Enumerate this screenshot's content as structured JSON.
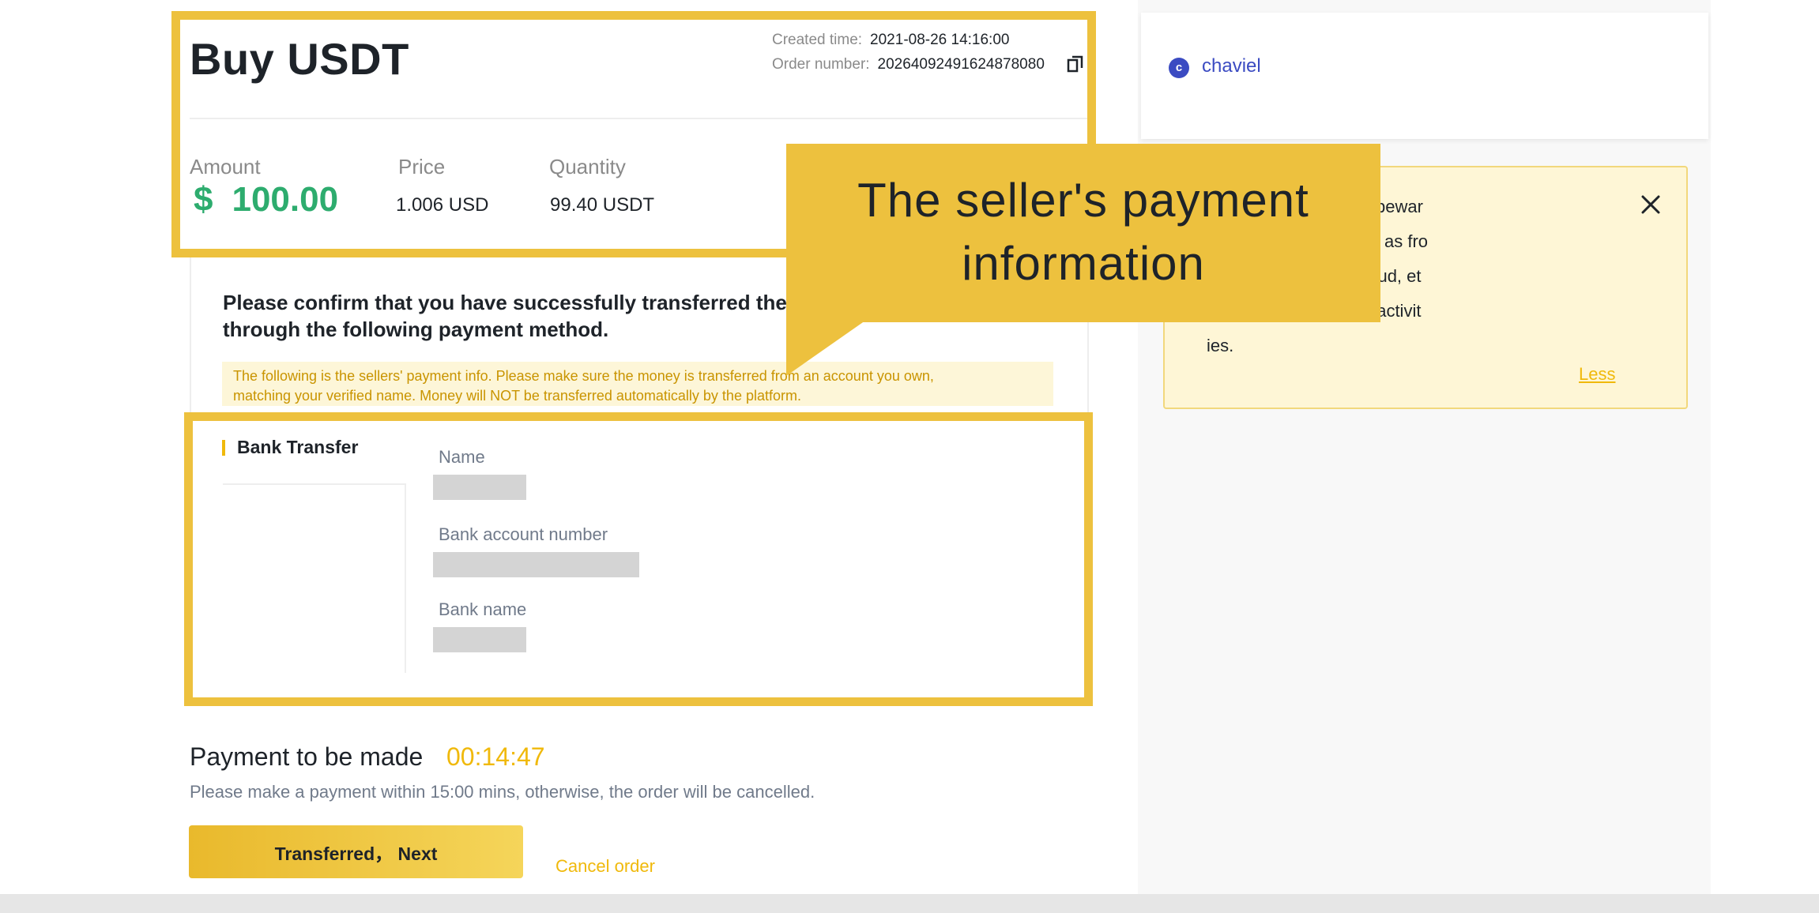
{
  "order": {
    "title": "Buy USDT",
    "created_label": "Created time:",
    "created_value": "2021-08-26 14:16:00",
    "order_label": "Order number:",
    "order_value": "20264092491624878080"
  },
  "stats": {
    "amount_label": "Amount",
    "amount_currency": "$",
    "amount_value": "100.00",
    "price_label": "Price",
    "price_value": "1.006",
    "price_unit": "USD",
    "quantity_label": "Quantity",
    "quantity_value": "99.40",
    "quantity_unit": "USDT"
  },
  "confirm": {
    "text_line1": "Please confirm that you have successfully transferred the",
    "text_line2": "through the following payment method.",
    "notice_line1": "The following is the sellers' payment info. Please make sure the money is transferred from an account you own,",
    "notice_line2": "matching your verified name. Money will NOT be transferred automatically by the platform."
  },
  "bank": {
    "title": "Bank Transfer",
    "name_label": "Name",
    "account_label": "Bank account number",
    "bank_name_label": "Bank name"
  },
  "payment": {
    "title": "Payment to be made",
    "timer": "00:14:47",
    "subtitle": "Please make a payment within 15:00 mins, otherwise, the order will be cancelled.",
    "next_button": "Transferred， Next",
    "cancel_link": "Cancel order"
  },
  "user": {
    "avatar_initial": "c",
    "name": "chaviel"
  },
  "warning": {
    "lines": [
      "ase invest wisely and bewar",
      "e of illegal funds (such as fro",
      "points, fundraising, fraud, et",
      "igital currency trading activit",
      "ies."
    ],
    "less_link": "Less"
  },
  "callout": {
    "line1": "The seller's payment",
    "line2": "information"
  },
  "colors": {
    "highlight": "#edc13e",
    "brand_yellow": "#f0b90b",
    "amount_green": "#2dac6e",
    "user_blue": "#3b4bc2"
  },
  "icons": [
    "copy-icon",
    "close-icon"
  ]
}
